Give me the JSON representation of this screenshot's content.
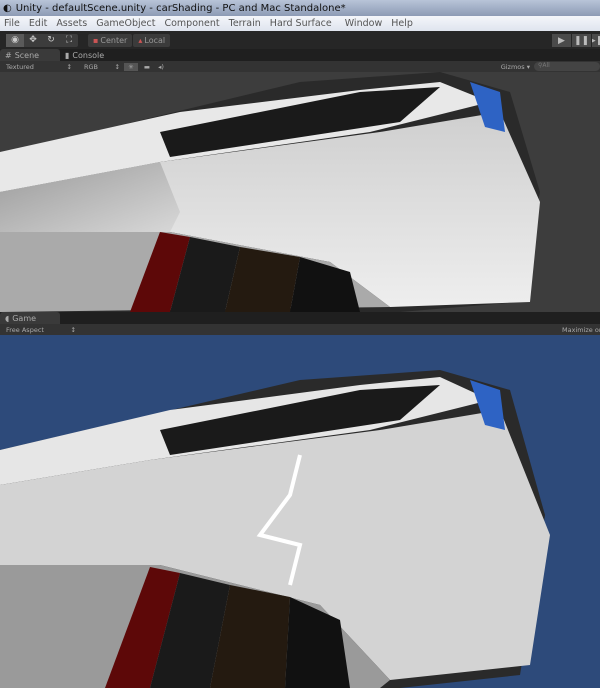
{
  "window": {
    "title": "Unity - defaultScene.unity - carShading - PC and Mac Standalone*"
  },
  "menu": [
    "File",
    "Edit",
    "Assets",
    "GameObject",
    "Component",
    "Terrain",
    "Hard Surface",
    "Window",
    "Help"
  ],
  "toolbar": {
    "tools": [
      "view-icon",
      "move-icon",
      "rotate-icon",
      "scale-icon"
    ],
    "pivot": "Center",
    "space": "Local",
    "play": "▶",
    "pause": "❚❚",
    "step": "▶❚"
  },
  "scene": {
    "tabs": [
      "Scene",
      "Console"
    ],
    "render_mode": "Textured",
    "color_mode": "RGB",
    "gizmos": "Gizmos",
    "search_placeholder": "All"
  },
  "game": {
    "tab": "Game",
    "aspect": "Free Aspect",
    "maximize": "Maximize on Play"
  },
  "colors": {
    "scene_bg": "#3d3d3d",
    "game_bg": "#2d4a7a"
  }
}
